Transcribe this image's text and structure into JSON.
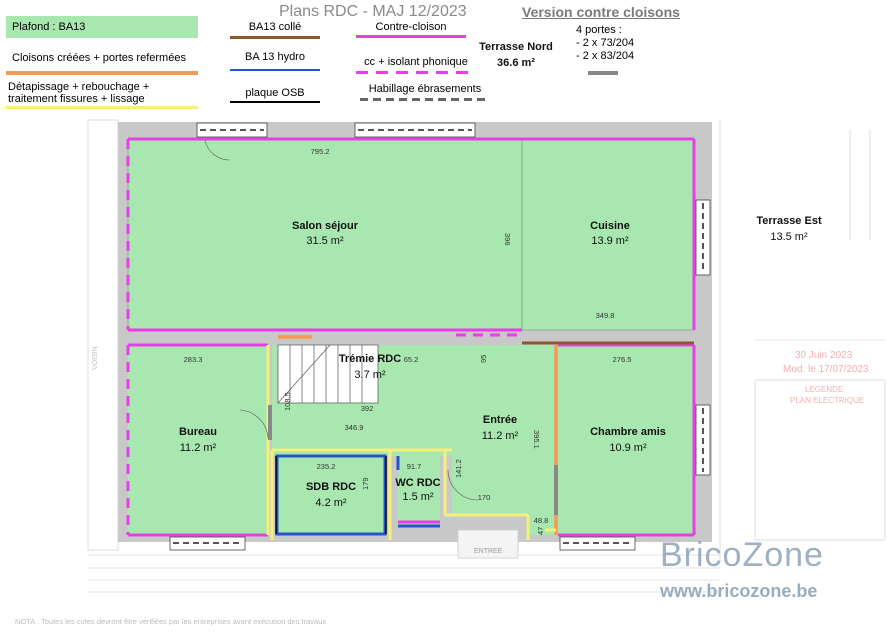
{
  "title": "Plans RDC - MAJ 12/2023",
  "subtitle": "Version contre cloisons",
  "legend": {
    "plafond": "Plafond : BA13",
    "cloisons": "Cloisons créées + portes refermées",
    "detapissage_line1": "Détapissage + rebouchage +",
    "detapissage_line2": "traitement fissures + lissage",
    "ba13_colle": "BA13 collé",
    "ba13_hydro": "BA 13 hydro",
    "plaque_osb": "plaque OSB",
    "contre_cloison": "Contre-cloison",
    "cc_isolant": "cc + isolant phonique",
    "habillage": "Habillage ébrasements",
    "portes_title": "4 portes :",
    "portes_1": "- 2 x 73/204",
    "portes_2": "- 2 x 83/204"
  },
  "colors": {
    "green_fill": "#a8e8b0",
    "orange": "#f59a55",
    "yellow": "#f5f07a",
    "brown": "#8b5a2b",
    "blue": "#2255cc",
    "magenta": "#e83ee8",
    "gray": "#888888",
    "black": "#000000"
  },
  "rooms": {
    "terrasse_nord": {
      "name": "Terrasse Nord",
      "area": "36.6 m²"
    },
    "terrasse_est": {
      "name": "Terrasse Est",
      "area": "13.5 m²"
    },
    "salon": {
      "name": "Salon séjour",
      "area": "31.5 m²"
    },
    "cuisine": {
      "name": "Cuisine",
      "area": "13.9 m²"
    },
    "tremie": {
      "name": "Trémie RDC",
      "area": "3.7 m²"
    },
    "bureau": {
      "name": "Bureau",
      "area": "11.2 m²"
    },
    "entree": {
      "name": "Entrée",
      "area": "11.2 m²"
    },
    "chambre": {
      "name": "Chambre amis",
      "area": "10.9 m²"
    },
    "sdb": {
      "name": "SDB RDC",
      "area": "4.2 m²"
    },
    "wc": {
      "name": "WC RDC",
      "area": "1.5 m²"
    }
  },
  "dimensions": {
    "d1": "795.2",
    "d2": "396",
    "d3": "349.8",
    "d4": "283.3",
    "d5": "65.2",
    "d6": "95",
    "d7": "276.5",
    "d8": "392",
    "d9": "108.5",
    "d10": "346.9",
    "d11": "395.1",
    "d12": "235.2",
    "d13": "91.7",
    "d14": "179",
    "d15": "141.2",
    "d16": "170",
    "d17": "48.8",
    "d18": "47"
  },
  "background": {
    "voisin": "VOISIN",
    "entree_sign": "ENTREE",
    "note": "NOTA : Toutes les cotes devront être vérifiées par les entreprises avant exécution des travaux",
    "date1": "30 Juin 2023",
    "date2": "Mod. le 17/07/2023",
    "legende1": "LEGENDE",
    "legende2": "PLAN ELECTRIQUE"
  },
  "watermark": {
    "brand": "BricoZone",
    "url": "www.bricozone.be"
  }
}
